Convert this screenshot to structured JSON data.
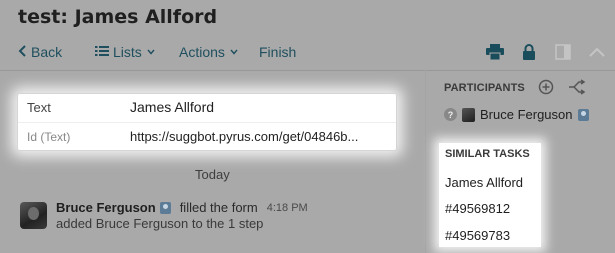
{
  "header": {
    "title": "test: James Allford"
  },
  "toolbar": {
    "back_label": "Back",
    "lists_label": "Lists",
    "actions_label": "Actions",
    "finish_label": "Finish",
    "icons": [
      "printer-icon",
      "lock-icon",
      "panel-toggle-icon",
      "chevron-up-icon"
    ],
    "accent_color": "#1f4f5e"
  },
  "form": {
    "rows": [
      {
        "label": "Text",
        "value": "James Allford"
      },
      {
        "label": "Id (Text)",
        "value": "https://suggbot.pyrus.com/get/04846b..."
      }
    ]
  },
  "feed": {
    "day_label": "Today",
    "activity": {
      "author": "Bruce Ferguson",
      "verb": "filled the form",
      "time": "4:18 PM",
      "detail": "added Bruce Ferguson to the 1 step"
    }
  },
  "sidebar": {
    "participants_heading": "PARTICIPANTS",
    "participant_name": "Bruce Ferguson",
    "similar_heading": "SIMILAR TASKS",
    "similar_items": [
      "James Allford",
      "#49569812",
      "#49569783"
    ]
  }
}
